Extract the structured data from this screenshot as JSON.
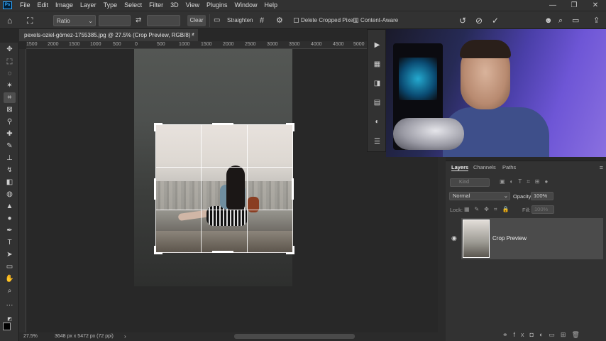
{
  "menu": [
    "File",
    "Edit",
    "Image",
    "Layer",
    "Type",
    "Select",
    "Filter",
    "3D",
    "View",
    "Plugins",
    "Window",
    "Help"
  ],
  "app_logo": "Ps",
  "window_controls": [
    "—",
    "❐",
    "✕"
  ],
  "options": {
    "ratio_label": "Ratio",
    "clear_label": "Clear",
    "straighten_label": "Straighten",
    "delete_cropped_label": "Delete Cropped Pixels",
    "content_aware_label": "Content-Aware"
  },
  "document": {
    "tab_title": "pexels-oziel-gómez-1755385.jpg @ 27.5% (Crop Preview, RGB/8) *",
    "close": "×",
    "zoom": "27.5%",
    "info": "3648 px x 5472 px (72 ppi)"
  },
  "ruler_labels": [
    "1500",
    "2000",
    "1500",
    "1000",
    "500",
    "0",
    "500",
    "1000",
    "1500",
    "2000",
    "2500",
    "3000",
    "3500",
    "4000",
    "4500",
    "5000"
  ],
  "tools": [
    "move-icon",
    "marquee-icon",
    "lasso-icon",
    "magic-wand-icon",
    "crop-icon",
    "frame-icon",
    "eyedropper-icon",
    "healing-icon",
    "brush-icon",
    "stamp-icon",
    "history-brush-icon",
    "eraser-icon",
    "gradient-icon",
    "blur-icon",
    "dodge-icon",
    "pen-icon",
    "type-icon",
    "path-select-icon",
    "shape-icon",
    "hand-icon",
    "zoom-icon",
    "more-icon"
  ],
  "layers_panel": {
    "tabs": [
      "Layers",
      "Channels",
      "Paths"
    ],
    "search_placeholder": "Kind",
    "blend_mode": "Normal",
    "opacity_label": "Opacity:",
    "opacity_value": "100%",
    "lock_label": "Lock:",
    "fill_label": "Fill:",
    "fill_value": "100%",
    "layer_name": "Crop Preview"
  }
}
